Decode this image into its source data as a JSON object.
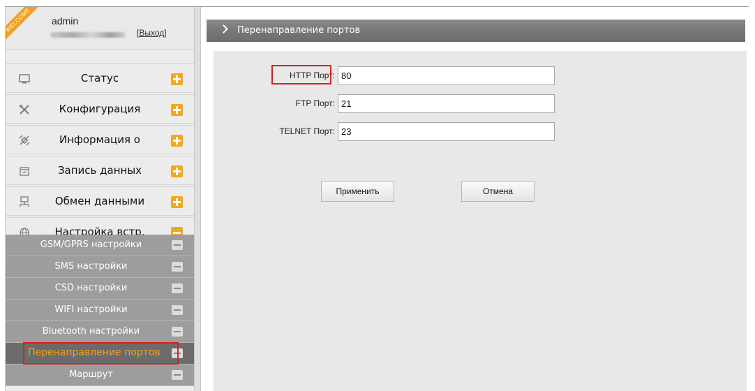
{
  "user": {
    "welcome_ribbon": "WELCOME",
    "name": "admin",
    "logout_label": "[Выход]"
  },
  "sidebar": {
    "menu": [
      {
        "label": "Статус",
        "icon": "monitor-icon",
        "toggle": "plus"
      },
      {
        "label": "Конфигурация",
        "icon": "tools-icon",
        "toggle": "plus"
      },
      {
        "label": "Информация о",
        "icon": "satellite-icon",
        "toggle": "plus"
      },
      {
        "label": "Запись данных",
        "icon": "calendar-icon",
        "toggle": "plus"
      },
      {
        "label": "Обмен данными",
        "icon": "network-icon",
        "toggle": "plus"
      },
      {
        "label": "Настройка встр.",
        "icon": "globe-icon",
        "toggle": "minus"
      }
    ],
    "submenu": [
      {
        "label": "GSM/GPRS настройки"
      },
      {
        "label": "SMS настройки"
      },
      {
        "label": "CSD настройки"
      },
      {
        "label": "WIFI настройки"
      },
      {
        "label": "Bluetooth настройки"
      },
      {
        "label": "Перенаправление портов",
        "active": true
      },
      {
        "label": "Маршрут"
      }
    ]
  },
  "page": {
    "title": "Перенаправление портов"
  },
  "form": {
    "http_label": "HTTP Порт:",
    "http_value": "80",
    "ftp_label": "FTP Порт:",
    "ftp_value": "21",
    "telnet_label": "TELNET Порт:",
    "telnet_value": "23",
    "apply_label": "Применить",
    "cancel_label": "Отмена"
  },
  "colors": {
    "accent": "#f0a020",
    "highlight": "#e11b1b",
    "title_bar": "#7a7a7a"
  }
}
